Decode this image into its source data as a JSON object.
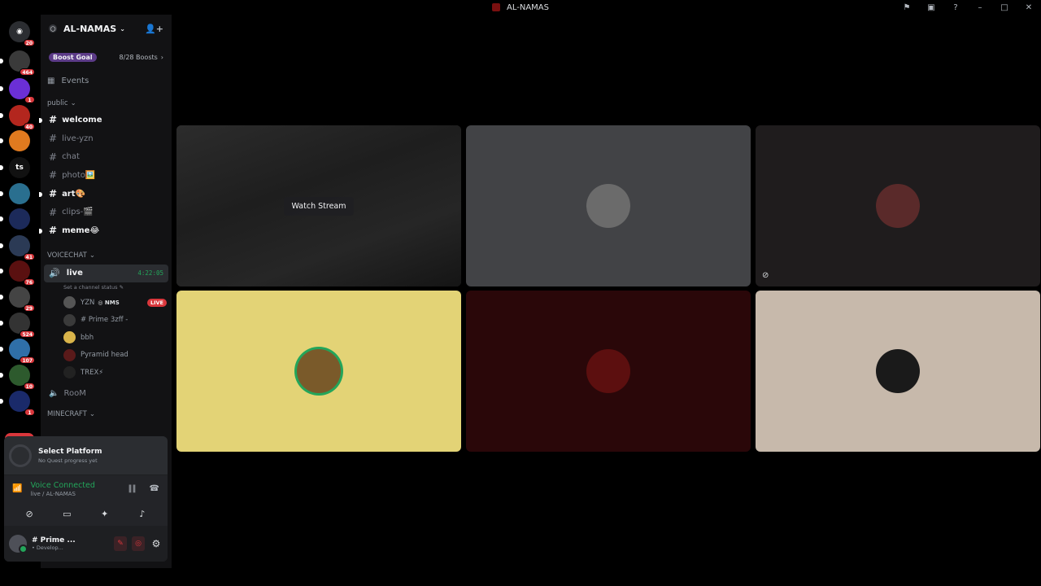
{
  "window": {
    "title": "AL-NAMAS",
    "controls": [
      "flag-icon",
      "inbox-icon",
      "help-icon",
      "minimize-icon",
      "maximize-icon",
      "close-icon"
    ]
  },
  "servers": {
    "home_badge": "20",
    "items": [
      {
        "badge": "464",
        "color": "#3a3a3a",
        "label": ""
      },
      {
        "badge": "1",
        "color": "#6b2fd6",
        "label": ""
      },
      {
        "badge": "40",
        "color": "#b3261e",
        "label": ""
      },
      {
        "badge": "",
        "color": "#e07a1f",
        "label": ""
      },
      {
        "badge": "",
        "color": "#111111",
        "label": "ts"
      },
      {
        "badge": "",
        "color": "#2a6f8f",
        "label": ""
      },
      {
        "badge": "",
        "color": "#1c2a5a",
        "label": ""
      },
      {
        "badge": "41",
        "color": "#2b3a55",
        "label": ""
      },
      {
        "badge": "76",
        "color": "#5a1010",
        "label": ""
      },
      {
        "badge": "29",
        "color": "#444444",
        "label": ""
      },
      {
        "badge": "524",
        "color": "#333333",
        "label": ""
      },
      {
        "badge": "107",
        "color": "#2f6fa8",
        "label": ""
      },
      {
        "badge": "10",
        "color": "#2d5a2d",
        "label": ""
      },
      {
        "badge": "1",
        "color": "#1a2a6a",
        "label": ""
      }
    ],
    "new_label": "NEW"
  },
  "guild": {
    "name": "AL-NAMAS",
    "boost_goal": "Boost Goal",
    "boost_count": "8/28 Boosts",
    "events": "Events"
  },
  "categories": {
    "public": "public",
    "voice": "VOICECHAT",
    "minecraft": "MINECRAFT"
  },
  "text_channels": [
    {
      "name": "welcome",
      "unread": true
    },
    {
      "name": "live-yzn",
      "unread": false
    },
    {
      "name": "chat",
      "unread": false
    },
    {
      "name": "photo🖼️",
      "unread": false
    },
    {
      "name": "art🎨",
      "unread": true
    },
    {
      "name": "clips-🎬",
      "unread": false
    },
    {
      "name": "meme😂",
      "unread": true
    }
  ],
  "voice_channel": {
    "name": "live",
    "timer": "4:22:05",
    "status_placeholder": "Set a channel status",
    "users": [
      {
        "name": "YZN",
        "tag": "NMS",
        "live": "LIVE"
      },
      {
        "name": "# Prime 3zff -",
        "tag": "",
        "live": ""
      },
      {
        "name": "bbh",
        "tag": "",
        "live": ""
      },
      {
        "name": "Pyramid head",
        "tag": "",
        "live": ""
      },
      {
        "name": "TREX⚡",
        "tag": "",
        "live": ""
      }
    ]
  },
  "room_channel": "RooM",
  "quest": {
    "title": "Select Platform",
    "subtitle": "No Quest progress yet"
  },
  "voice_status": {
    "title": "Voice Connected",
    "subtitle": "live / AL-NAMAS"
  },
  "user": {
    "name": "# Prime ...",
    "status": "• Develop..."
  },
  "stage": {
    "watch_label": "Watch Stream",
    "tiles": [
      {
        "bg": "#2a2a2a",
        "avatar": "",
        "kind": "stream"
      },
      {
        "bg": "#424346",
        "avatar": "#6b6b6b",
        "kind": "avatar"
      },
      {
        "bg": "#1f1c1d",
        "avatar": "#5a2a2a",
        "kind": "avatar-camoff"
      },
      {
        "bg": "#e3d376",
        "avatar": "#7a5a2a",
        "kind": "avatar-speaking"
      },
      {
        "bg": "#2a0709",
        "avatar": "#5c0f0f",
        "kind": "avatar"
      },
      {
        "bg": "#c7b9ab",
        "avatar": "#1a1a1a",
        "kind": "avatar"
      }
    ]
  }
}
